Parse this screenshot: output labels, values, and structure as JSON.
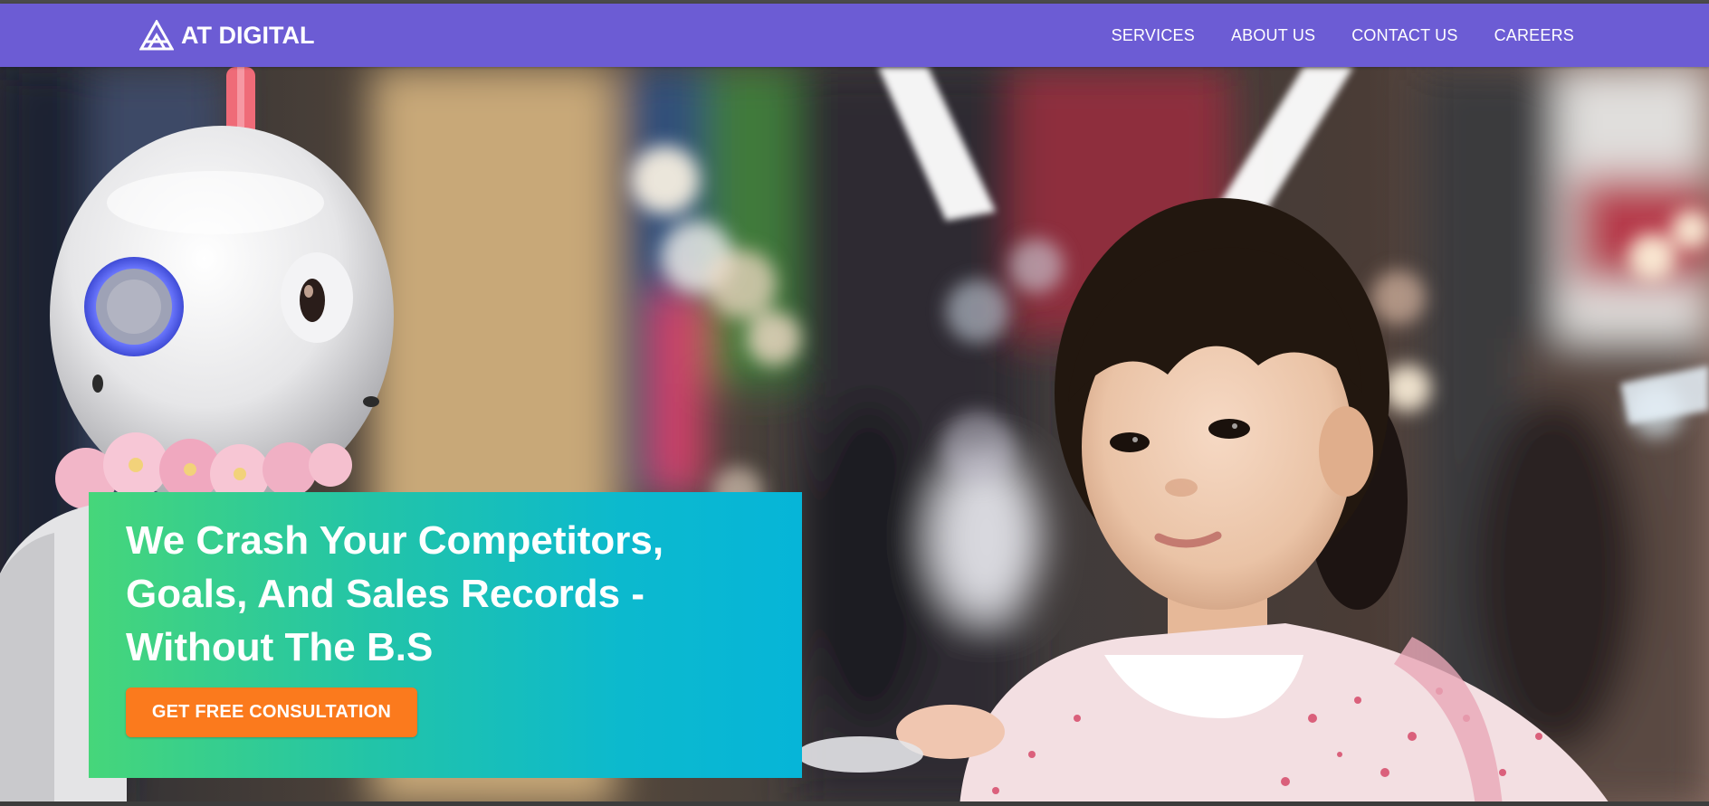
{
  "brand": {
    "name": "AT DIGITAL",
    "icon": "triangle-logo-icon",
    "color": "#6c5cd4"
  },
  "nav": {
    "items": [
      {
        "label": "SERVICES"
      },
      {
        "label": "ABOUT US"
      },
      {
        "label": "CONTACT US"
      },
      {
        "label": "CAREERS"
      }
    ]
  },
  "hero": {
    "image": "robot-and-girl-photo",
    "headline": "We Crash Your Competitors, Goals, And Sales Records - Without The B.S",
    "cta_label": "GET FREE CONSULTATION",
    "cta_color": "#fb7a1d",
    "card_gradient": [
      "#46d67a",
      "#06b5d8"
    ]
  }
}
